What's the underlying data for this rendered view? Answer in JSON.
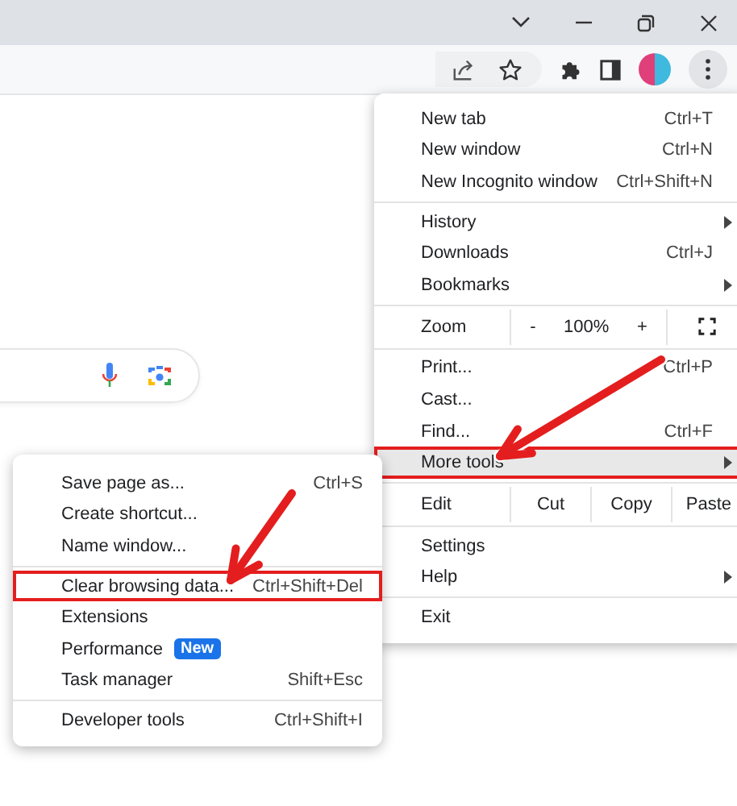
{
  "menu": {
    "sections": [
      [
        {
          "kind": "item",
          "label": "New tab",
          "shortcut": "Ctrl+T",
          "has_submenu": false,
          "selected": false,
          "highlighted": false
        },
        {
          "kind": "item",
          "label": "New window",
          "shortcut": "Ctrl+N",
          "has_submenu": false,
          "selected": false,
          "highlighted": false
        },
        {
          "kind": "item",
          "label": "New Incognito window",
          "shortcut": "Ctrl+Shift+N",
          "has_submenu": false,
          "selected": false,
          "highlighted": false
        }
      ],
      [
        {
          "kind": "item",
          "label": "History",
          "has_submenu": true,
          "selected": false,
          "highlighted": false
        },
        {
          "kind": "item",
          "label": "Downloads",
          "shortcut": "Ctrl+J",
          "has_submenu": false,
          "selected": false,
          "highlighted": false
        },
        {
          "kind": "item",
          "label": "Bookmarks",
          "has_submenu": true,
          "selected": false,
          "highlighted": false
        }
      ],
      [
        {
          "kind": "zoom",
          "label": "Zoom",
          "minus": "-",
          "value": "100%",
          "plus": "+"
        }
      ],
      [
        {
          "kind": "item",
          "label": "Print...",
          "shortcut": "Ctrl+P",
          "has_submenu": false,
          "selected": false,
          "highlighted": false
        },
        {
          "kind": "item",
          "label": "Cast...",
          "has_submenu": false,
          "selected": false,
          "highlighted": false
        },
        {
          "kind": "item",
          "label": "Find...",
          "shortcut": "Ctrl+F",
          "has_submenu": false,
          "selected": false,
          "highlighted": false
        },
        {
          "kind": "item",
          "label": "More tools",
          "has_submenu": true,
          "selected": true,
          "highlighted": true
        }
      ],
      [
        {
          "kind": "edit",
          "label": "Edit",
          "actions": [
            "Cut",
            "Copy",
            "Paste"
          ]
        }
      ],
      [
        {
          "kind": "item",
          "label": "Settings",
          "has_submenu": false,
          "selected": false,
          "highlighted": false
        },
        {
          "kind": "item",
          "label": "Help",
          "has_submenu": true,
          "selected": false,
          "highlighted": false
        }
      ],
      [
        {
          "kind": "item",
          "label": "Exit",
          "has_submenu": false,
          "selected": false,
          "highlighted": false
        }
      ]
    ]
  },
  "submenu": {
    "sections": [
      [
        {
          "kind": "item",
          "label": "Save page as...",
          "shortcut": "Ctrl+S",
          "selected": false,
          "highlighted": false
        },
        {
          "kind": "item",
          "label": "Create shortcut...",
          "selected": false,
          "highlighted": false
        },
        {
          "kind": "item",
          "label": "Name window...",
          "selected": false,
          "highlighted": false
        }
      ],
      [
        {
          "kind": "item",
          "label": "Clear browsing data...",
          "shortcut": "Ctrl+Shift+Del",
          "selected": false,
          "highlighted": true
        },
        {
          "kind": "item",
          "label": "Extensions",
          "selected": false,
          "highlighted": false
        },
        {
          "kind": "item",
          "label": "Performance",
          "badge": "New",
          "selected": false,
          "highlighted": false
        },
        {
          "kind": "item",
          "label": "Task manager",
          "shortcut": "Shift+Esc",
          "selected": false,
          "highlighted": false
        }
      ],
      [
        {
          "kind": "item",
          "label": "Developer tools",
          "shortcut": "Ctrl+Shift+I",
          "selected": false,
          "highlighted": false
        }
      ]
    ]
  }
}
